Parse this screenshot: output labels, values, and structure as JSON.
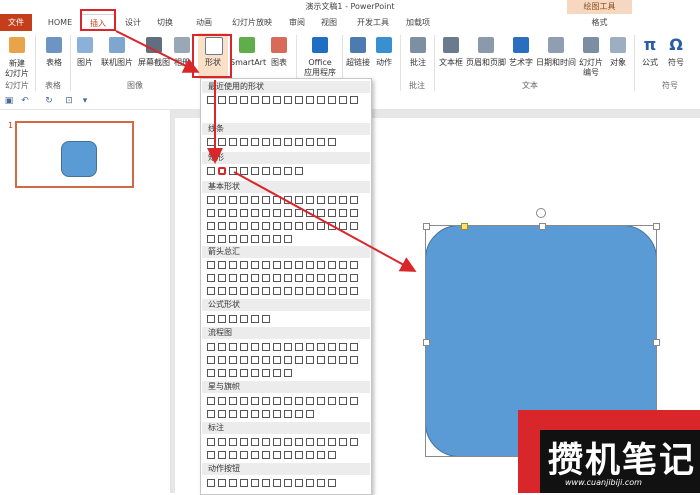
{
  "title": "演示文稿1 - PowerPoint",
  "contextual_tab_group": "绘图工具",
  "tabs": [
    "文件",
    "HOME",
    "插入",
    "设计",
    "切换",
    "动画",
    "幻灯片放映",
    "审阅",
    "视图",
    "开发工具",
    "加载项",
    "格式"
  ],
  "ribbon": {
    "buttons": [
      {
        "label": "新建\n幻灯片",
        "icon": "new-slide-icon"
      },
      {
        "label": "表格",
        "icon": "table-icon"
      },
      {
        "label": "图片",
        "icon": "picture-icon"
      },
      {
        "label": "联机图片",
        "icon": "online-picture-icon"
      },
      {
        "label": "屏幕截图",
        "icon": "screenshot-icon"
      },
      {
        "label": "相册",
        "icon": "album-icon"
      },
      {
        "label": "形状",
        "icon": "shapes-icon"
      },
      {
        "label": "SmartArt",
        "icon": "smartart-icon"
      },
      {
        "label": "图表",
        "icon": "chart-icon"
      },
      {
        "label": "Office\n应用程序",
        "icon": "office-apps-icon"
      },
      {
        "label": "超链接",
        "icon": "hyperlink-icon"
      },
      {
        "label": "动作",
        "icon": "action-icon"
      },
      {
        "label": "批注",
        "icon": "comment-icon"
      },
      {
        "label": "文本框",
        "icon": "textbox-icon"
      },
      {
        "label": "页眉和页脚",
        "icon": "header-footer-icon"
      },
      {
        "label": "艺术字",
        "icon": "wordart-icon"
      },
      {
        "label": "日期和时间",
        "icon": "datetime-icon"
      },
      {
        "label": "幻灯片\n编号",
        "icon": "slide-number-icon"
      },
      {
        "label": "对象",
        "icon": "object-icon"
      },
      {
        "label": "公式",
        "icon": "equation-icon"
      },
      {
        "label": "符号",
        "icon": "symbol-icon"
      }
    ],
    "groups": [
      "幻灯片",
      "表格",
      "图像",
      "批注",
      "文本",
      "符号"
    ]
  },
  "thumbnail": {
    "slide_number": "1"
  },
  "gallery": {
    "sections": [
      "最近使用的形状",
      "线条",
      "矩形",
      "基本形状",
      "箭头总汇",
      "公式形状",
      "流程图",
      "星与旗帜",
      "标注",
      "动作按钮"
    ]
  },
  "watermark": {
    "text": "攒机笔记",
    "url": "www.cuanjibiji.com"
  },
  "colors": {
    "accent": "#c43e1c",
    "shape_fill": "#5b9bd5",
    "annotation": "#d9262b"
  }
}
